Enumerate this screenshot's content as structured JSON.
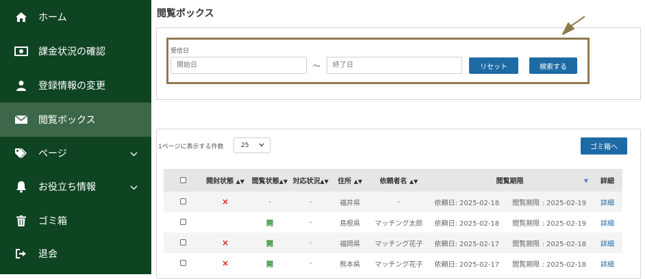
{
  "sidebar": {
    "items": [
      {
        "label": "ホーム",
        "icon": "home-icon"
      },
      {
        "label": "課金状況の確認",
        "icon": "money-icon"
      },
      {
        "label": "登録情報の変更",
        "icon": "user-icon"
      },
      {
        "label": "閲覧ボックス",
        "icon": "envelope-icon"
      },
      {
        "label": "ページ",
        "icon": "tags-icon"
      },
      {
        "label": "お役立ち情報",
        "icon": "bell-icon"
      },
      {
        "label": "ゴミ箱",
        "icon": "trash-icon"
      },
      {
        "label": "退会",
        "icon": "sign-out-icon"
      }
    ]
  },
  "main": {
    "title": "閲覧ボックス",
    "filter": {
      "label": "受信日",
      "start_placeholder": "開始日",
      "separator": "～",
      "end_placeholder": "終了日",
      "reset_label": "リセット",
      "search_label": "検索する"
    },
    "list": {
      "per_page_label": "1ページに表示する件数",
      "per_page_value": "25",
      "trash_button": "ゴミ箱へ",
      "columns": {
        "open_status": "開封状態",
        "view_status": "閲覧状態",
        "response_status": "対応状況",
        "address": "住所",
        "requester": "依頼者名",
        "period": "閲覧期限",
        "detail": "詳細"
      },
      "rows": [
        {
          "open": "×",
          "view": "-",
          "response": "-",
          "address": "福井県",
          "requester": "-",
          "requested": "依頼日: 2025-02-18",
          "deadline": "閲覧期限 : 2025-02-19",
          "detail": "詳細"
        },
        {
          "open": "",
          "view": "開",
          "response": "-",
          "address": "島根県",
          "requester": "マッチング太郎",
          "requested": "依頼日: 2025-02-18",
          "deadline": "閲覧期限 : 2025-02-19",
          "detail": "詳細"
        },
        {
          "open": "×",
          "view": "開",
          "response": "-",
          "address": "福岡県",
          "requester": "マッチング花子",
          "requested": "依頼日: 2025-02-17",
          "deadline": "閲覧期限 : 2025-02-18",
          "detail": "詳細"
        },
        {
          "open": "×",
          "view": "開",
          "response": "-",
          "address": "熊本県",
          "requester": "マッチング花子",
          "requested": "依頼日: 2025-02-17",
          "deadline": "閲覧期限 : 2025-02-18",
          "detail": "詳細"
        }
      ]
    }
  },
  "colors": {
    "sidebar": "#0f4423",
    "active": "#3d6749",
    "button": "#1e6aa5",
    "highlight": "#8f7a4e"
  }
}
